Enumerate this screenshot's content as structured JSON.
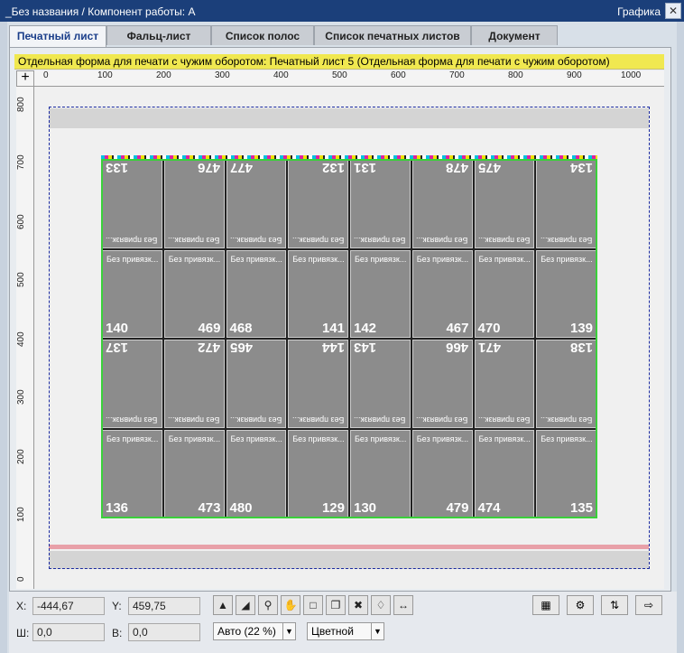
{
  "window": {
    "title": "_Без названия / Компонент работы: A",
    "right_title": "Графика",
    "close_glyph": "✕"
  },
  "tabs": [
    {
      "label": "Печатный лист"
    },
    {
      "label": "Фальц-лист"
    },
    {
      "label": "Список полос"
    },
    {
      "label": "Список печатных листов"
    },
    {
      "label": "Документ"
    }
  ],
  "info_bar": "Отдельная форма для печати с чужим оборотом:  Печатный лист 5 (Отдельная форма для печати с чужим оборотом)",
  "ruler": {
    "h_ticks": [
      "0",
      "100",
      "200",
      "300",
      "400",
      "500",
      "600",
      "700",
      "800",
      "900",
      "1000"
    ],
    "v_ticks": [
      "800",
      "700",
      "600",
      "500",
      "400",
      "300",
      "200",
      "100",
      "0"
    ]
  },
  "page_label": "Без привязк...",
  "rows": [
    [
      "133",
      "476",
      "477",
      "132",
      "131",
      "478",
      "475",
      "134"
    ],
    [
      "140",
      "469",
      "468",
      "141",
      "142",
      "467",
      "470",
      "139"
    ],
    [
      "137",
      "472",
      "465",
      "144",
      "143",
      "466",
      "471",
      "138"
    ],
    [
      "136",
      "473",
      "480",
      "129",
      "130",
      "479",
      "474",
      "135"
    ]
  ],
  "coords": {
    "x_label": "X:",
    "x_value": "-444,67",
    "y_label": "Y:",
    "y_value": "459,75",
    "w_label": "Ш:",
    "w_value": "0,0",
    "h_label": "В:",
    "h_value": "0,0"
  },
  "toolbar": {
    "icons": [
      "select-arrow-icon",
      "select-sheet-icon",
      "zoom-icon",
      "hand-icon",
      "crop-icon",
      "copy-icon",
      "cross-icon",
      "tag-icon",
      "distance-icon"
    ],
    "zoom_select": "Авто (22 %)",
    "color_select": "Цветной"
  }
}
